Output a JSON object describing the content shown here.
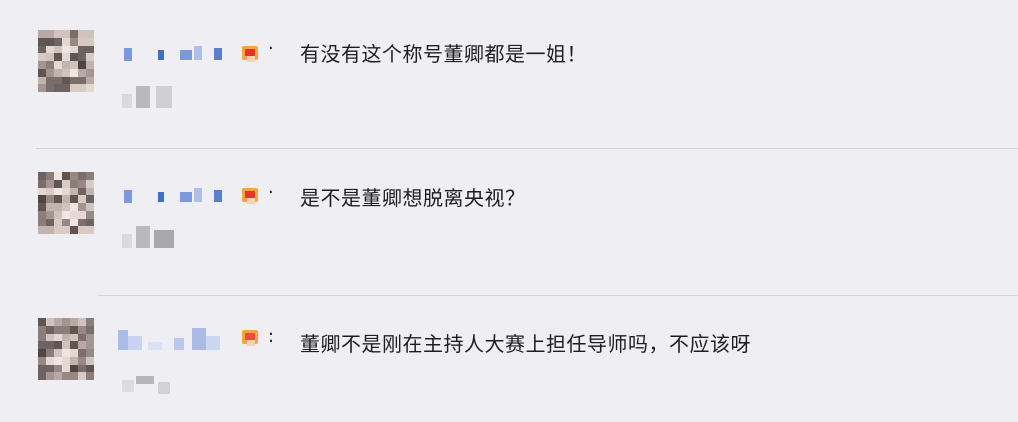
{
  "comments": [
    {
      "separator": "·",
      "text": "有没有这个称号董卿都是一姐！"
    },
    {
      "separator": "·",
      "text": "是不是董卿想脱离央视？"
    },
    {
      "separator": ":",
      "text": "董卿不是刚在主持人大赛上担任导师吗，不应该呀"
    }
  ],
  "colors": {
    "background": "#efeef3",
    "divider": "#d4d3d9",
    "username_blur": "#5b7fd0",
    "text": "#1e1e1e"
  }
}
